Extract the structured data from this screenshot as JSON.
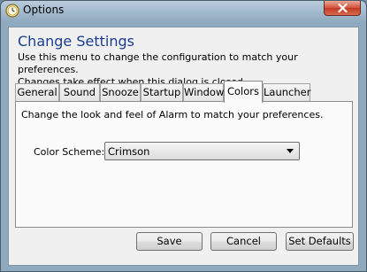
{
  "window": {
    "title": "Options"
  },
  "header": {
    "heading": "Change Settings",
    "description_line1": "Use this menu to change the configuration to match your preferences.",
    "description_line2": "Changes take effect when this dialog is closed."
  },
  "tabs": [
    {
      "label": "General"
    },
    {
      "label": "Sound"
    },
    {
      "label": "Snooze"
    },
    {
      "label": "Startup"
    },
    {
      "label": "Window"
    },
    {
      "label": "Colors",
      "active": true
    },
    {
      "label": "Launcher"
    }
  ],
  "colors_tab": {
    "description": "Change the look and feel of Alarm to match your preferences.",
    "color_scheme_label": "Color Scheme:",
    "color_scheme_value": "Crimson"
  },
  "buttons": {
    "save": "Save",
    "cancel": "Cancel",
    "set_defaults": "Set Defaults"
  },
  "icons": {
    "app": "clock-icon",
    "close": "close-icon",
    "dropdown": "chevron-down-icon"
  }
}
